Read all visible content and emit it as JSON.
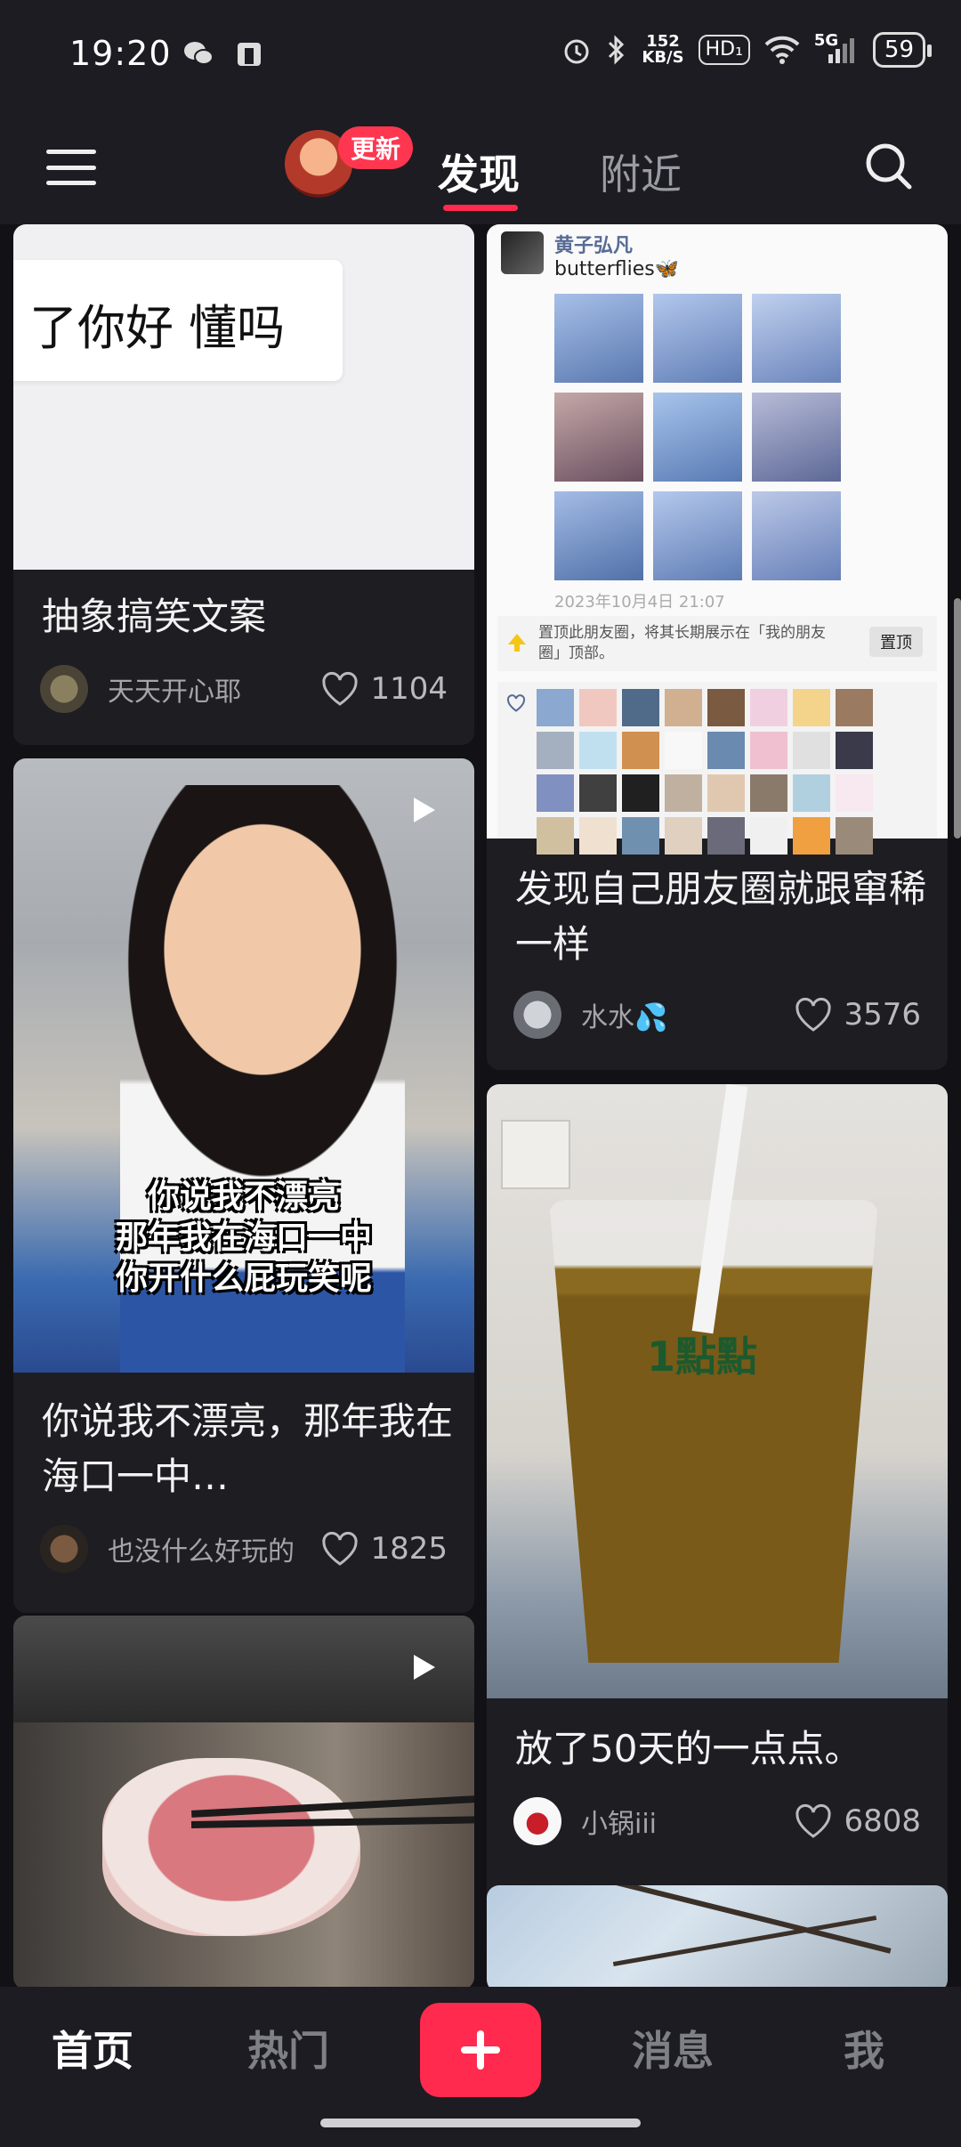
{
  "status_bar": {
    "time": "19:20",
    "net_speed_value": "152",
    "net_speed_unit": "KB/S",
    "hd_label": "HD₁",
    "network_label": "5G",
    "battery": "59"
  },
  "top_nav": {
    "update_badge": "更新",
    "tabs": [
      {
        "label": "发现",
        "active": true
      },
      {
        "label": "附近",
        "active": false
      }
    ]
  },
  "feed": {
    "cards": [
      {
        "title": "抽象搞笑文案",
        "author": "天天开心耶",
        "likes": "1104",
        "image_text": "了你好 懂吗"
      },
      {
        "title": "你说我不漂亮，那年我在海口一中…",
        "author": "也没什么好玩的",
        "likes": "1825",
        "overlay_lines": [
          "你说我不漂亮",
          "那年我在海口一中",
          "你开什么屁玩笑呢"
        ]
      },
      {
        "title": "",
        "author": "",
        "likes": ""
      },
      {
        "title": "发现自己朋友圈就跟窜稀一样",
        "author": "水水💦",
        "likes": "3576",
        "moments_name": "黄子弘凡",
        "moments_caption": "butterflies🦋",
        "moments_date": "2023年10月4日 21:07",
        "pin_text": "置顶此朋友圈，将其长期展示在「我的朋友圈」顶部。",
        "pin_button": "置顶"
      },
      {
        "title": "放了50天的一点点。",
        "author": "小锅iii",
        "likes": "6808",
        "cup_brand": "1點點"
      }
    ]
  },
  "bottom_nav": {
    "items": [
      "首页",
      "热门",
      "消息",
      "我"
    ]
  }
}
